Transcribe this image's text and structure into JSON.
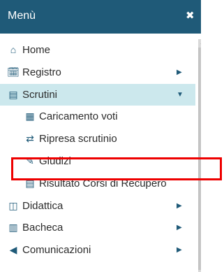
{
  "header": {
    "title": "Menù",
    "close_icon": "close-icon"
  },
  "menu": {
    "home": {
      "label": "Home",
      "icon": "home-icon"
    },
    "registro": {
      "label": "Registro",
      "icon": "calendar-icon"
    },
    "scrutini": {
      "label": "Scrutini",
      "icon": "scrutini-icon",
      "expanded": true
    },
    "caricamento_voti": {
      "label": "Caricamento voti",
      "icon": "grid-icon"
    },
    "ripresa_scrutinio": {
      "label": "Ripresa scrutinio",
      "icon": "retweet-icon"
    },
    "giudizi": {
      "label": "Giudizi",
      "icon": "edit-icon"
    },
    "risultato_corsi": {
      "label": "Risultato Corsi di Recupero",
      "icon": "document-icon"
    },
    "didattica": {
      "label": "Didattica",
      "icon": "book-icon"
    },
    "bacheca": {
      "label": "Bacheca",
      "icon": "newspaper-icon"
    },
    "comunicazioni": {
      "label": "Comunicazioni",
      "icon": "megaphone-icon"
    }
  },
  "colors": {
    "accent": "#1f5a78",
    "active_bg": "#cce8ed",
    "highlight": "#ee0000"
  }
}
